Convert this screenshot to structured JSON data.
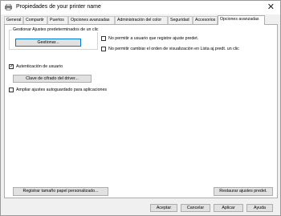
{
  "window": {
    "title": "Propiedades de your printer name",
    "close_glyph": "✕"
  },
  "tabs": [
    {
      "label": "General"
    },
    {
      "label": "Compartir"
    },
    {
      "label": "Puertos"
    },
    {
      "label": "Opciones avanzadas"
    },
    {
      "label": "Administración del color"
    },
    {
      "label": "Seguridad"
    },
    {
      "label": "Accesorios"
    },
    {
      "label": "Opciones avanzadas",
      "active": true
    }
  ],
  "group": {
    "label": "Gestionar Ajustes predeterminados de un clic",
    "button": "Gestionar..."
  },
  "options": {
    "no_register": {
      "label": "No permitir a usuario que registre ajuste predet.",
      "checked": false
    },
    "no_reorder": {
      "label": "No permitir cambiar el orden de visualización en Lista aj.predt. un clic",
      "checked": false
    },
    "user_auth": {
      "label": "Autenticación de usuario",
      "checked": true
    },
    "driver_key": {
      "label": "Clave de cifrado del driver..."
    },
    "autosave": {
      "label": "Ampliar ajustes autoguardado para aplicaciones",
      "checked": false
    }
  },
  "bottom": {
    "register_paper": "Registrar tamaño papel personalizado...",
    "restore_defaults": "Restaurar ajustes predet."
  },
  "footer": {
    "ok": "Aceptar",
    "cancel": "Cancelar",
    "apply": "Aplicar",
    "help": "Ayuda"
  },
  "colors": {
    "focus_border": "#0078d7",
    "dialog_bg": "#f0f0f0"
  }
}
